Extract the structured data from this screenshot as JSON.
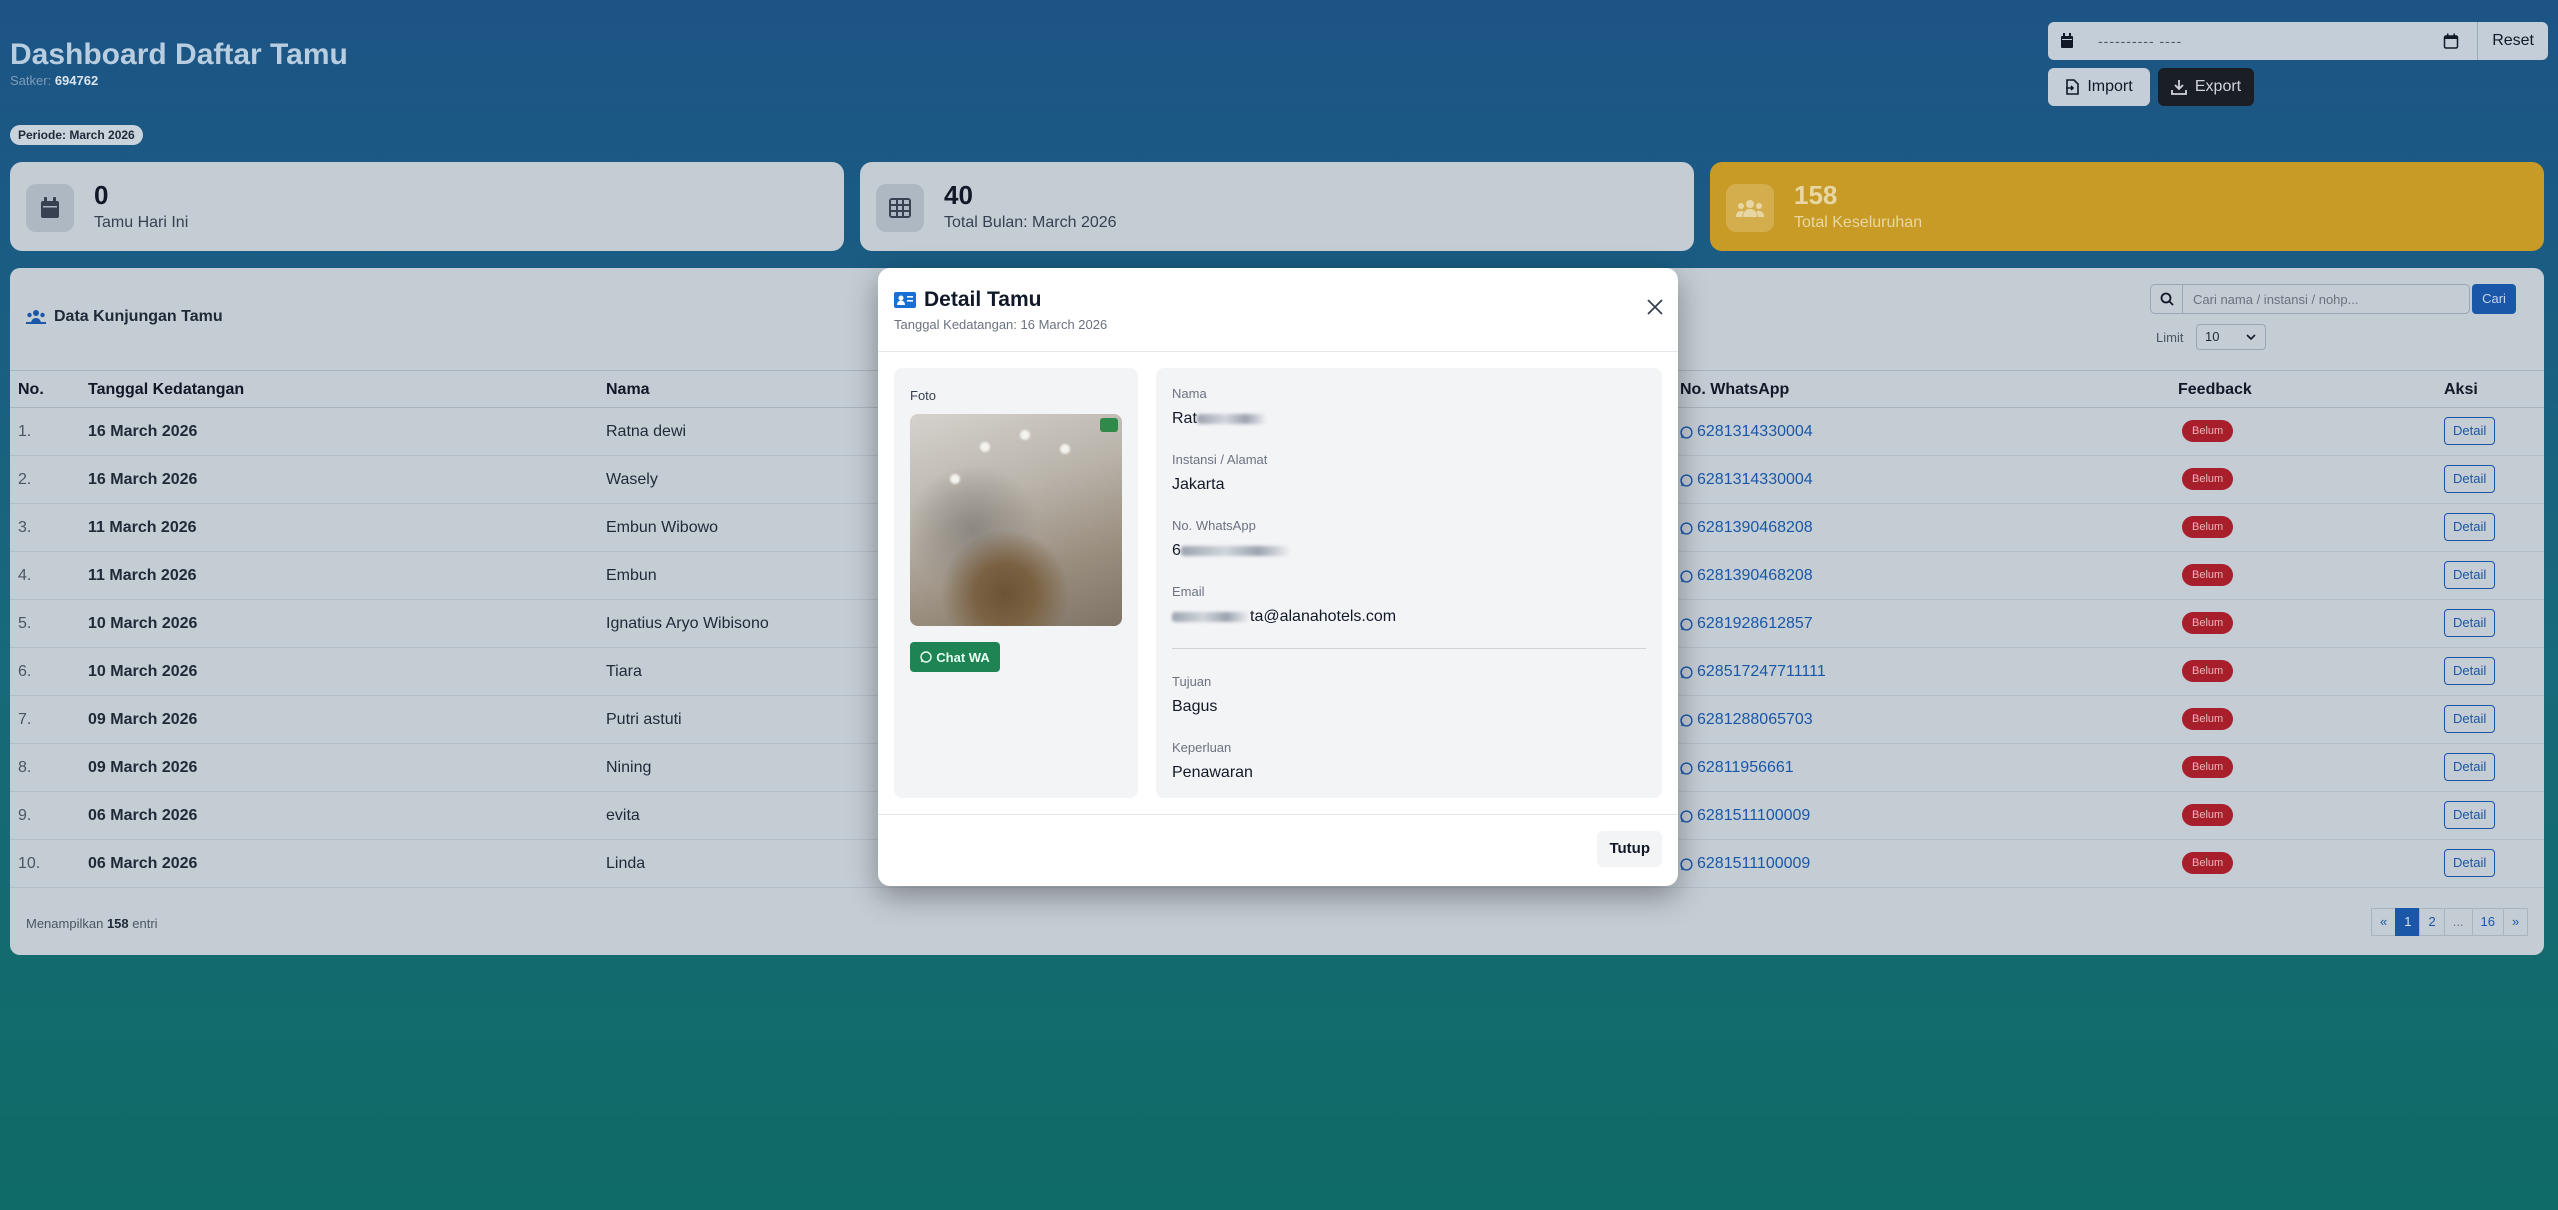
{
  "header": {
    "title": "Dashboard Daftar Tamu",
    "satker_label": "Satker:",
    "satker_value": "694762",
    "periode": "Periode: March 2026",
    "date_placeholder": "---------- ----",
    "reset_label": "Reset",
    "import_label": "Import",
    "export_label": "Export"
  },
  "stats": [
    {
      "value": "0",
      "label": "Tamu Hari Ini",
      "icon": "calendar-icon"
    },
    {
      "value": "40",
      "label": "Total Bulan: March 2026",
      "icon": "table-icon"
    },
    {
      "value": "158",
      "label": "Total Keseluruhan",
      "icon": "users-icon"
    }
  ],
  "panel": {
    "title": "Data Kunjungan Tamu",
    "search_placeholder": "Cari nama / instansi / nohp...",
    "search_button": "Cari",
    "limit_label": "Limit",
    "limit_value": "10",
    "columns": [
      "No.",
      "Tanggal Kedatangan",
      "Nama",
      "No. WhatsApp",
      "Feedback",
      "Aksi"
    ],
    "rows": [
      {
        "no": "1.",
        "date": "16 March 2026",
        "name": "Ratna dewi",
        "wa": "6281314330004",
        "feedback": "Belum",
        "action": "Detail"
      },
      {
        "no": "2.",
        "date": "16 March 2026",
        "name": "Wasely",
        "wa": "6281314330004",
        "feedback": "Belum",
        "action": "Detail"
      },
      {
        "no": "3.",
        "date": "11 March 2026",
        "name": "Embun Wibowo",
        "wa": "6281390468208",
        "feedback": "Belum",
        "action": "Detail"
      },
      {
        "no": "4.",
        "date": "11 March 2026",
        "name": "Embun",
        "wa": "6281390468208",
        "feedback": "Belum",
        "action": "Detail"
      },
      {
        "no": "5.",
        "date": "10 March 2026",
        "name": "Ignatius Aryo Wibisono",
        "wa": "6281928612857",
        "feedback": "Belum",
        "action": "Detail"
      },
      {
        "no": "6.",
        "date": "10 March 2026",
        "name": "Tiara",
        "wa": "628517247711111",
        "feedback": "Belum",
        "action": "Detail"
      },
      {
        "no": "7.",
        "date": "09 March 2026",
        "name": "Putri astuti",
        "wa": "6281288065703",
        "feedback": "Belum",
        "action": "Detail"
      },
      {
        "no": "8.",
        "date": "09 March 2026",
        "name": "Nining",
        "wa": "62811956661",
        "feedback": "Belum",
        "action": "Detail"
      },
      {
        "no": "9.",
        "date": "06 March 2026",
        "name": "evita",
        "wa": "6281511100009",
        "feedback": "Belum",
        "action": "Detail"
      },
      {
        "no": "10.",
        "date": "06 March 2026",
        "name": "Linda",
        "wa": "6281511100009",
        "feedback": "Belum",
        "action": "Detail"
      }
    ],
    "footer_prefix": "Menampilkan",
    "footer_count": "158",
    "footer_suffix": "entri",
    "pagination": [
      "«",
      "1",
      "2",
      "...",
      "16",
      "»"
    ]
  },
  "modal": {
    "title": "Detail Tamu",
    "subtitle": "Tanggal Kedatangan: 16 March 2026",
    "photo_label": "Foto",
    "chat_button": "Chat WA",
    "fields": {
      "nama_label": "Nama",
      "nama_value": "Rat",
      "instansi_label": "Instansi / Alamat",
      "instansi_value": "Jakarta",
      "wa_label": "No. WhatsApp",
      "wa_value": "6",
      "email_label": "Email",
      "email_value": "ta@alanahotels.com",
      "tujuan_label": "Tujuan",
      "tujuan_value": "Bagus",
      "keperluan_label": "Keperluan",
      "keperluan_value": "Penawaran"
    },
    "close_button": "Tutup"
  },
  "colors": {
    "accent": "#1a57a8",
    "badge": "#a61f2b",
    "whatsapp": "#1e8454",
    "gold_card": "#c79b26"
  }
}
